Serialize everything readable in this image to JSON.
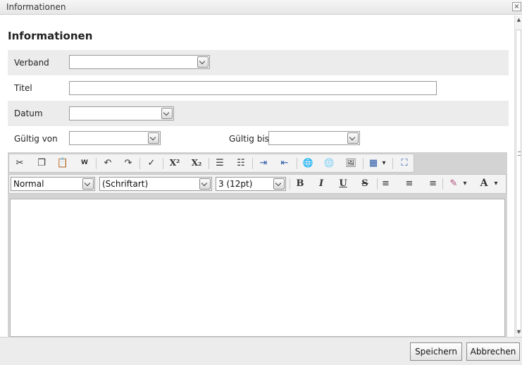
{
  "window": {
    "title": "Informationen",
    "close_symbol": "×"
  },
  "form": {
    "heading": "Informationen",
    "verband": {
      "label": "Verband",
      "value": ""
    },
    "titel": {
      "label": "Titel",
      "value": ""
    },
    "datum": {
      "label": "Datum",
      "value": ""
    },
    "gueltig_von": {
      "label": "Gültig von",
      "value": ""
    },
    "gueltig_bis": {
      "label": "Gültig bis",
      "value": ""
    }
  },
  "editor": {
    "toolbar1": [
      {
        "name": "cut-icon",
        "glyph": "✂",
        "disabled": true
      },
      {
        "name": "copy-icon",
        "glyph": "❐",
        "disabled": true
      },
      {
        "name": "paste-icon",
        "glyph": "📋",
        "disabled": true
      },
      {
        "name": "paste-word-icon",
        "glyph": "W",
        "disabled": true
      },
      {
        "name": "undo-icon",
        "glyph": "↶",
        "disabled": true
      },
      {
        "name": "redo-icon",
        "glyph": "↷",
        "disabled": true
      },
      {
        "name": "spellcheck-icon",
        "glyph": "✓",
        "disabled": true
      },
      {
        "name": "superscript-icon",
        "glyph": "X²",
        "disabled": false
      },
      {
        "name": "subscript-icon",
        "glyph": "X₂",
        "disabled": false
      },
      {
        "name": "numbered-list-icon",
        "glyph": "☰",
        "disabled": false
      },
      {
        "name": "bulleted-list-icon",
        "glyph": "☷",
        "disabled": false
      },
      {
        "name": "indent-icon",
        "glyph": "⇥",
        "disabled": false
      },
      {
        "name": "outdent-icon",
        "glyph": "⇤",
        "disabled": false
      },
      {
        "name": "link-icon",
        "glyph": "🌐",
        "disabled": false
      },
      {
        "name": "unlink-icon",
        "glyph": "🌐",
        "disabled": true
      },
      {
        "name": "image-icon",
        "glyph": "🖼",
        "disabled": false
      },
      {
        "name": "table-icon",
        "glyph": "▦",
        "disabled": false
      },
      {
        "name": "table-dropdown-icon",
        "glyph": "▾",
        "disabled": false
      },
      {
        "name": "maximize-icon",
        "glyph": "⛶",
        "disabled": false
      }
    ],
    "format": {
      "value": "Normal"
    },
    "font": {
      "value": "(Schriftart)"
    },
    "size": {
      "value": "3 (12pt)"
    },
    "toolbar2": [
      {
        "name": "bold-icon",
        "glyph": "B"
      },
      {
        "name": "italic-icon",
        "glyph": "I"
      },
      {
        "name": "underline-icon",
        "glyph": "U"
      },
      {
        "name": "strikethrough-icon",
        "glyph": "S"
      },
      {
        "name": "align-left-icon",
        "glyph": "≡"
      },
      {
        "name": "align-center-icon",
        "glyph": "≡"
      },
      {
        "name": "align-right-icon",
        "glyph": "≡"
      },
      {
        "name": "highlight-color-icon",
        "glyph": "✎"
      },
      {
        "name": "highlight-dropdown-icon",
        "glyph": "▾"
      },
      {
        "name": "font-color-icon",
        "glyph": "A"
      },
      {
        "name": "font-color-dropdown-icon",
        "glyph": "▾"
      }
    ]
  },
  "footer": {
    "save_label": "Speichern",
    "cancel_label": "Abbrechen"
  }
}
